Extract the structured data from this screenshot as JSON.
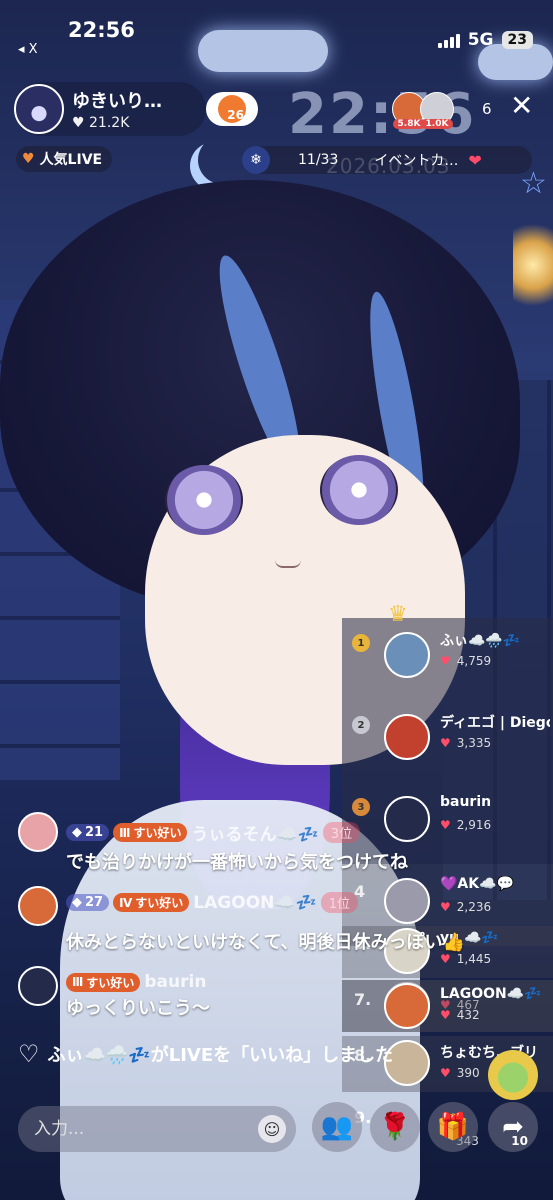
{
  "status_bar": {
    "time": "22:56",
    "back_label": "◂ X",
    "network": "5G",
    "battery": "23"
  },
  "background": {
    "clock": "22:56",
    "date": "2026.03.03"
  },
  "host": {
    "name": "ゆきいり…",
    "likes": "21.2K",
    "heart_level": "26"
  },
  "viewers": {
    "avatar_scores": [
      "5.8K",
      "1.0K"
    ],
    "count": "6"
  },
  "tags": {
    "popular": "人気LIVE",
    "event_progress": "11/33",
    "event_title": "イベントカ…"
  },
  "ranking": [
    {
      "rank": "1",
      "name": "ふぃ☁️🌧️💤",
      "score": "4,759",
      "color": "#6a8fb8"
    },
    {
      "rank": "2",
      "name": "ディエゴ | Diego",
      "score": "3,335",
      "color": "#c2402e"
    },
    {
      "rank": "3",
      "name": "baurin",
      "score": "2,916",
      "color": "#232a4a"
    },
    {
      "rank": "4",
      "name": "💜AK☁️💬",
      "score": "2,236",
      "color": "#9a9aaa"
    },
    {
      "rank": "5.",
      "name": "yu ☁️💤",
      "score": "1,445",
      "color": "#d8d4c8"
    },
    {
      "rank": "6.",
      "name": "",
      "score": "467",
      "color": "#c9c7c0"
    },
    {
      "rank": "7.",
      "name": "LAGOON☁️💤",
      "score": "432",
      "color": "#d86a3a"
    },
    {
      "rank": "8.",
      "name": "ちょむち…ブリ",
      "score": "390",
      "color": "#c9b59a"
    },
    {
      "rank": "9.",
      "name": "",
      "score": "343",
      "color": "#aaa"
    }
  ],
  "chat": [
    {
      "level": "21",
      "fan_level": "Ⅲ",
      "fan_label": "すい好い",
      "username": "うぃるそん☁️💤",
      "place": "3位",
      "message": "でも治りかけが一番怖いから気をつけてね",
      "avatar_color": "#e8a3a8"
    },
    {
      "level": "27",
      "fan_level": "Ⅳ",
      "fan_label": "すい好い",
      "username": "LAGOON☁️💤",
      "place": "1位",
      "message": "休みとらないといけなくて、明後日休みっぽい👍",
      "avatar_color": "#d86a3a"
    },
    {
      "fan_level": "Ⅲ",
      "fan_label": "すい好い",
      "username": "baurin",
      "message": "ゆっくりいこう〜",
      "avatar_color": "#232a4a"
    }
  ],
  "like_notice": "ふぃ☁️🌧️💤がLIVEを「いいね」しました",
  "input": {
    "placeholder": "入力..."
  },
  "share_count": "10"
}
